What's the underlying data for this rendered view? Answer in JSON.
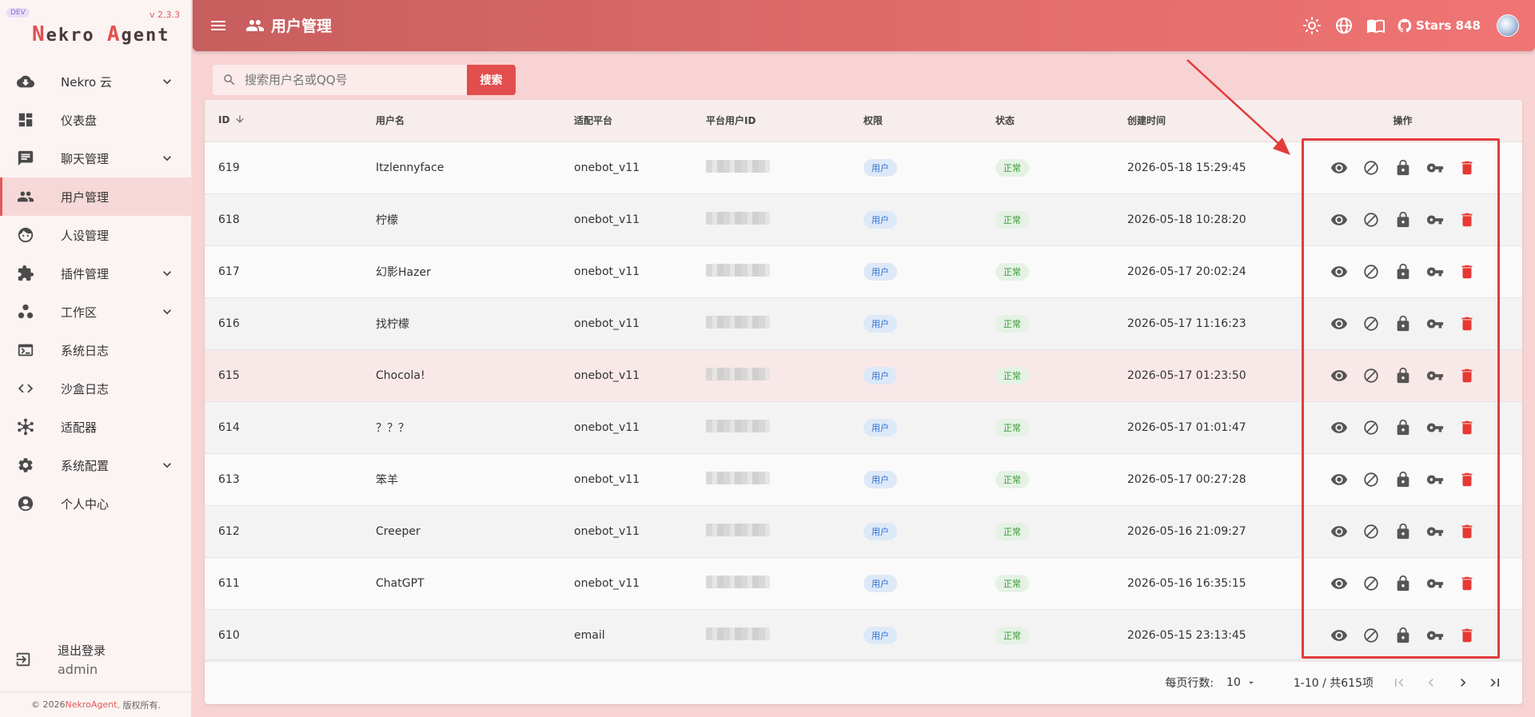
{
  "sidebar": {
    "dev_badge": "DEV",
    "version": "v 2.3.3",
    "brand_n": "N",
    "brand_ekro": "ekro ",
    "brand_a": "A",
    "brand_gent": "gent",
    "items": [
      {
        "label": "Nekro 云",
        "icon": "cloud-download-icon",
        "expandable": true
      },
      {
        "label": "仪表盘",
        "icon": "dashboard-icon",
        "expandable": false
      },
      {
        "label": "聊天管理",
        "icon": "chat-icon",
        "expandable": true
      },
      {
        "label": "用户管理",
        "icon": "users-icon",
        "expandable": false,
        "active": true
      },
      {
        "label": "人设管理",
        "icon": "face-icon",
        "expandable": false
      },
      {
        "label": "插件管理",
        "icon": "puzzle-icon",
        "expandable": true
      },
      {
        "label": "工作区",
        "icon": "workspace-icon",
        "expandable": true
      },
      {
        "label": "系统日志",
        "icon": "terminal-icon",
        "expandable": false
      },
      {
        "label": "沙盒日志",
        "icon": "code-icon",
        "expandable": false
      },
      {
        "label": "适配器",
        "icon": "hub-icon",
        "expandable": false
      },
      {
        "label": "系统配置",
        "icon": "gear-icon",
        "expandable": true
      },
      {
        "label": "个人中心",
        "icon": "account-icon",
        "expandable": false
      }
    ],
    "logout_label": "退出登录",
    "username": "admin",
    "footer_prefix": "© 2026 ",
    "footer_link": "NekroAgent",
    "footer_suffix": ". 版权所有."
  },
  "topbar": {
    "title": "用户管理",
    "stars_label": "Stars 848"
  },
  "search": {
    "placeholder": "搜索用户名或QQ号",
    "button_label": "搜索"
  },
  "table": {
    "headers": [
      "ID",
      "用户名",
      "适配平台",
      "平台用户ID",
      "权限",
      "状态",
      "创建时间",
      "操作"
    ],
    "rows": [
      {
        "id": "619",
        "username": "Itzlennyface",
        "platform": "onebot_v11",
        "role": "用户",
        "status": "正常",
        "created": "2026-05-18 15:29:45"
      },
      {
        "id": "618",
        "username": "柠檬",
        "platform": "onebot_v11",
        "role": "用户",
        "status": "正常",
        "created": "2026-05-18 10:28:20"
      },
      {
        "id": "617",
        "username": "幻影Hazer",
        "platform": "onebot_v11",
        "role": "用户",
        "status": "正常",
        "created": "2026-05-17 20:02:24"
      },
      {
        "id": "616",
        "username": "找柠檬",
        "platform": "onebot_v11",
        "role": "用户",
        "status": "正常",
        "created": "2026-05-17 11:16:23"
      },
      {
        "id": "615",
        "username": "Chocola!",
        "platform": "onebot_v11",
        "role": "用户",
        "status": "正常",
        "created": "2026-05-17 01:23:50"
      },
      {
        "id": "614",
        "username": "？？？",
        "platform": "onebot_v11",
        "role": "用户",
        "status": "正常",
        "created": "2026-05-17 01:01:47"
      },
      {
        "id": "613",
        "username": "笨羊",
        "platform": "onebot_v11",
        "role": "用户",
        "status": "正常",
        "created": "2026-05-17 00:27:28"
      },
      {
        "id": "612",
        "username": "Creeper",
        "platform": "onebot_v11",
        "role": "用户",
        "status": "正常",
        "created": "2026-05-16 21:09:27"
      },
      {
        "id": "611",
        "username": "ChatGPT",
        "platform": "onebot_v11",
        "role": "用户",
        "status": "正常",
        "created": "2026-05-16 16:35:15"
      },
      {
        "id": "610",
        "username": "",
        "platform": "email",
        "role": "用户",
        "status": "正常",
        "created": "2026-05-15 23:13:45"
      }
    ]
  },
  "pagination": {
    "rows_per_page_label": "每页行数:",
    "rows_per_page_value": "10",
    "range_label": "1-10 / 共615项"
  },
  "colors": {
    "accent": "#e24d4d",
    "topbar_start": "#c75e5e",
    "topbar_end": "#f07474",
    "delete": "#e53935"
  }
}
